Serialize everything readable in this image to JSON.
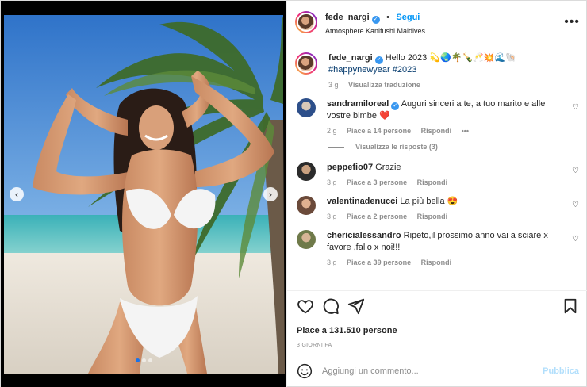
{
  "post": {
    "username": "fede_nargi",
    "follow_label": "Segui",
    "bullet": "•",
    "location": "Atmosphere Kanifushi Maldives",
    "more_label": "•••"
  },
  "caption": {
    "username": "fede_nargi",
    "text": "Hello 2023 💫🌏🌴🍾🥂💥🌊🐚",
    "hashtags": "#happynewyear #2023",
    "time": "3 g",
    "translate_label": "Visualizza traduzione"
  },
  "comments": [
    {
      "username": "sandramiloreal",
      "verified": true,
      "text": "Auguri sinceri a te, a tuo marito e alle vostre bimbe ❤️",
      "time": "2 g",
      "likes": "Piace a 14 persone",
      "reply": "Rispondi",
      "more": "•••"
    },
    {
      "username": "peppefio07",
      "text": "Grazie",
      "time": "3 g",
      "likes": "Piace a 3 persone",
      "reply": "Rispondi"
    },
    {
      "username": "valentinadenucci",
      "text": "La più bella 😍",
      "time": "3 g",
      "likes": "Piace a 2 persone",
      "reply": "Rispondi"
    },
    {
      "username": "chericialessandro",
      "text": "Ripeto,il prossimo anno vai a sciare x favore ,fallo x noi!!!",
      "time": "3 g",
      "likes": "Piace a 39 persone",
      "reply": "Rispondi"
    }
  ],
  "view_replies": "Visualizza le risposte (3)",
  "likes_text": "Piace a 131.510 persone",
  "post_date": "3 GIORNI FA",
  "add_comment": {
    "placeholder": "Aggiungi un commento...",
    "publish_label": "Pubblica"
  },
  "carousel": {
    "prev": "‹",
    "next": "›",
    "slides": 3,
    "active": 1
  },
  "colors": {
    "link": "#0095f6",
    "verified": "#3897f0",
    "muted": "#8e8e8e",
    "publish_disabled": "#b2dffc"
  },
  "icons": [
    "heart-icon",
    "comment-icon",
    "share-icon",
    "bookmark-icon",
    "emoji-icon",
    "more-icon",
    "verified-icon"
  ]
}
